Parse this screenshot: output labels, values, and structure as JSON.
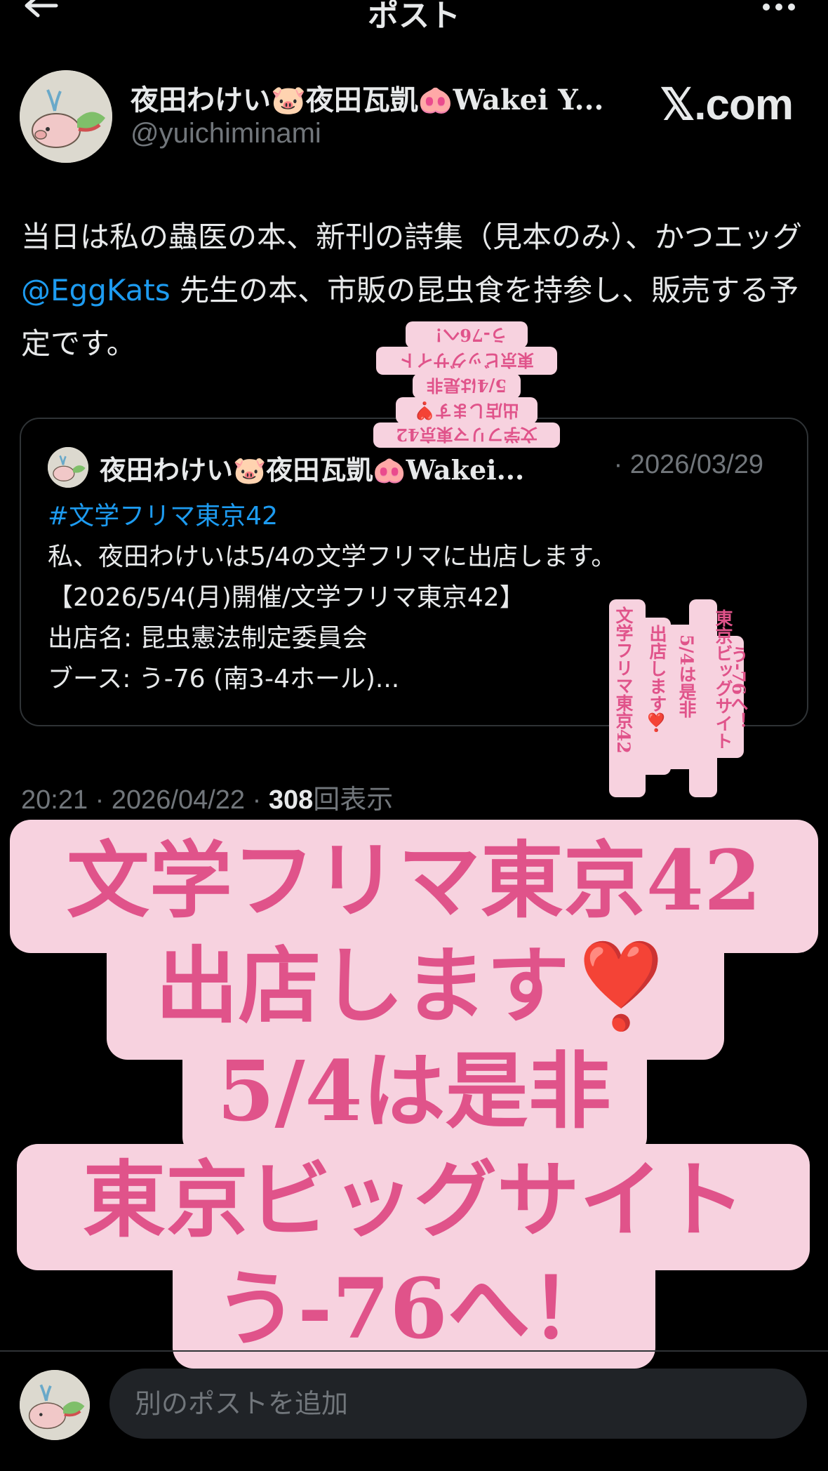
{
  "header": {
    "title": "ポスト"
  },
  "post": {
    "display_name": "夜田わけい🐷夜田瓦凱🐽Wakei Y...",
    "handle": "@yuichiminami",
    "watermark": "𝕏.com",
    "text_before_mention": "当日は私の蟲医の本、新刊の詩集（見本のみ）、かつエッグ",
    "mention": "@EggKats",
    "text_after_mention": " 先生の本、市販の昆虫食を持参し、販売する予定です。",
    "time": "20:21",
    "date": "2026/04/22",
    "views": "308",
    "views_label": "回表示",
    "separator": " · "
  },
  "quote": {
    "display_name": "夜田わけい🐷夜田瓦凱🐽Wakei...",
    "date": "· 2026/03/29",
    "hashtag": "#文学フリマ東京42",
    "lines": [
      "私、夜田わけいは5/4の文学フリマに出店します。",
      "【2026/5/4(月)開催/文学フリマ東京42】",
      "出店名: 昆虫憲法制定委員会",
      "ブース: う-76 (南3-4ホール)..."
    ]
  },
  "reply": {
    "placeholder": "別のポストを追加"
  },
  "sticker": {
    "lines": [
      "文学フリマ東京42",
      "出店します",
      "5/4は是非",
      "東京ビッグサイト",
      "う-76へ！"
    ],
    "heart": "❣️"
  },
  "icons": {
    "back": "back-arrow-icon",
    "more": "more-horizontal-icon"
  },
  "colors": {
    "background": "#000000",
    "text": "#e7e9ea",
    "muted": "#71767b",
    "link": "#1d9bf0",
    "sticker_bg": "#f7d2df",
    "sticker_text": "#e0538a"
  }
}
